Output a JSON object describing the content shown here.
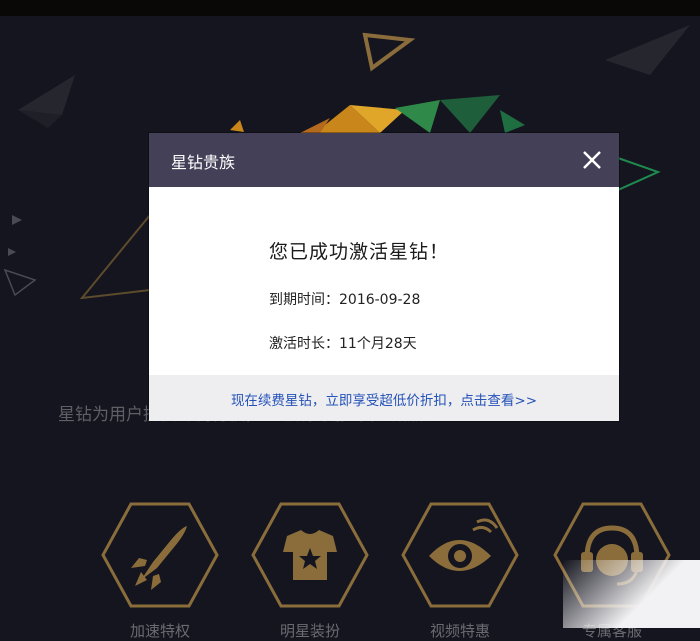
{
  "background": {
    "tagline": "星钻为用户提供专属特权，让您成为游戏中的焦点！",
    "features": [
      {
        "label": "加速特权",
        "icon": "rocket-icon"
      },
      {
        "label": "明星装扮",
        "icon": "star-shirt-icon"
      },
      {
        "label": "视频特惠",
        "icon": "eye-icon"
      },
      {
        "label": "专属客服",
        "icon": "headset-icon"
      }
    ]
  },
  "dialog": {
    "title": "星钻贵族",
    "close_icon": "close-icon",
    "success_message": "您已成功激活星钻！",
    "expiry_label": "到期时间：",
    "expiry_value": "2016-09-28",
    "duration_label": "激活时长：",
    "duration_value": "11个月28天",
    "footer_link": "现在续费星钻，立即享受超低价折扣，点击查看>>"
  },
  "colors": {
    "header": "#434058",
    "link": "#2452b8",
    "gold": "#8a6d3b",
    "background": "#15151f"
  }
}
